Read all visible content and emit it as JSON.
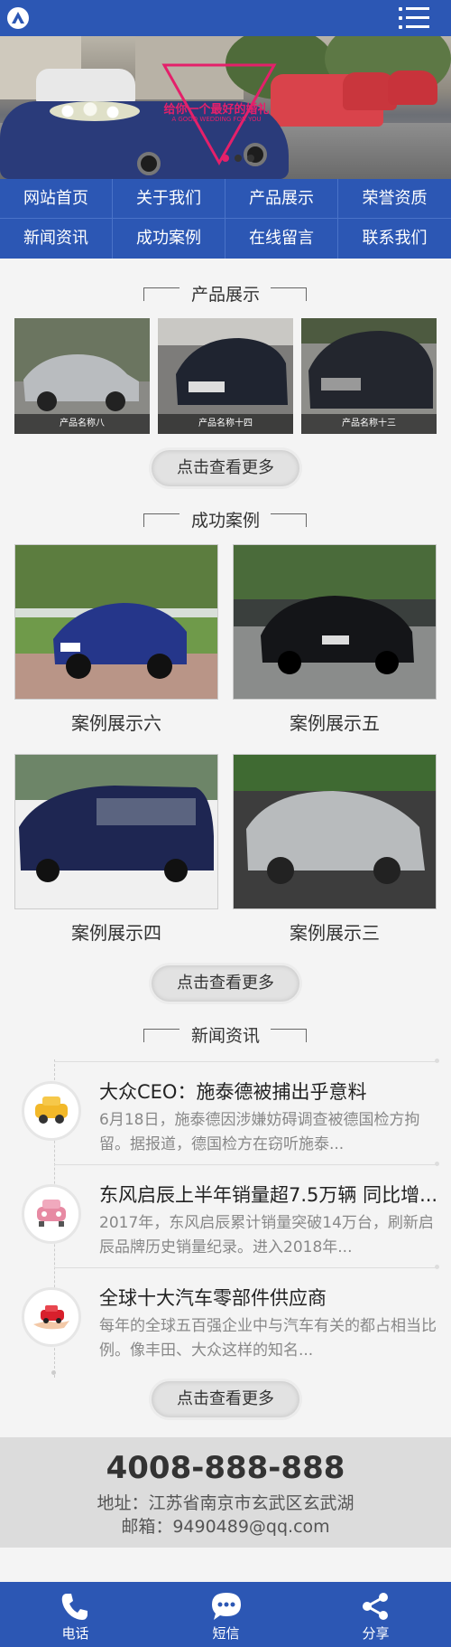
{
  "header": {
    "logo_icon": "logo-icon",
    "menu_icon": "hamburger-menu-icon"
  },
  "banner": {
    "title": "给你一个最好的婚礼",
    "subtitle": "A GOOD WEDDING FOR YOU",
    "slide_count": 3,
    "active_slide": 1
  },
  "nav": {
    "items": [
      {
        "label": "网站首页"
      },
      {
        "label": "关于我们"
      },
      {
        "label": "产品展示"
      },
      {
        "label": "荣誉资质"
      },
      {
        "label": "新闻资讯"
      },
      {
        "label": "成功案例"
      },
      {
        "label": "在线留言"
      },
      {
        "label": "联系我们"
      }
    ]
  },
  "products": {
    "title": "产品展示",
    "items": [
      {
        "caption": "产品名称八"
      },
      {
        "caption": "产品名称十四"
      },
      {
        "caption": "产品名称十三"
      }
    ],
    "more_label": "点击查看更多"
  },
  "cases": {
    "title": "成功案例",
    "items": [
      {
        "label": "案例展示六"
      },
      {
        "label": "案例展示五"
      },
      {
        "label": "案例展示四"
      },
      {
        "label": "案例展示三"
      }
    ],
    "more_label": "点击查看更多"
  },
  "news": {
    "title": "新闻资讯",
    "items": [
      {
        "title": "大众CEO：施泰德被捕出乎意料",
        "desc": "6月18日，施泰德因涉嫌妨碍调查被德国检方拘留。据报道，德国检方在窃听施泰...",
        "icon": "taxi-icon"
      },
      {
        "title": "东风启辰上半年销量超7.5万辆 同比增...",
        "desc": "2017年，东风启辰累计销量突破14万台，刷新启辰品牌历史销量纪录。进入2018年...",
        "icon": "car-front-icon"
      },
      {
        "title": "全球十大汽车零部件供应商",
        "desc": "每年的全球五百强企业中与汽车有关的都占相当比例。像丰田、大众这样的知名...",
        "icon": "toy-car-hand-icon"
      }
    ],
    "more_label": "点击查看更多"
  },
  "contact": {
    "phone": "4008-888-888",
    "address": "地址：江苏省南京市玄武区玄武湖",
    "email": "邮箱：9490489@qq.com"
  },
  "bottom_bar": {
    "items": [
      {
        "label": "电话",
        "icon": "phone-icon"
      },
      {
        "label": "短信",
        "icon": "sms-icon"
      },
      {
        "label": "分享",
        "icon": "share-icon"
      }
    ]
  },
  "colors": {
    "primary": "#2c57b4",
    "accent": "#e4206a",
    "background": "#f4f4f4"
  }
}
